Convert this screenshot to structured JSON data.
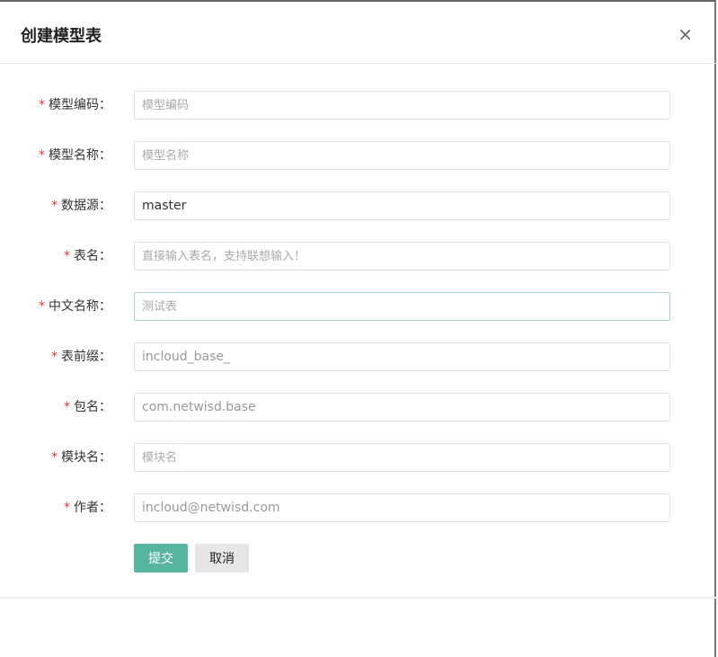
{
  "dialog": {
    "title": "创建模型表",
    "close_label": "×"
  },
  "form": {
    "fields": [
      {
        "label": "模型编码：",
        "value": "",
        "placeholder": "模型编码"
      },
      {
        "label": "模型名称：",
        "value": "",
        "placeholder": "模型名称"
      },
      {
        "label": "数据源：",
        "value": "master",
        "placeholder": ""
      },
      {
        "label": "表名：",
        "value": "",
        "placeholder": "直接输入表名，支持联想输入！"
      },
      {
        "label": "中文名称：",
        "value": "",
        "placeholder": "测试表"
      },
      {
        "label": "表前缀：",
        "value": "incloud_base_",
        "placeholder": ""
      },
      {
        "label": "包名：",
        "value": "com.netwisd.base",
        "placeholder": ""
      },
      {
        "label": "模块名：",
        "value": "",
        "placeholder": "模块名"
      },
      {
        "label": "作者：",
        "value": "incloud@netwisd.com",
        "placeholder": ""
      }
    ],
    "required_mark": "*",
    "submit_label": "提交",
    "cancel_label": "取消"
  },
  "colors": {
    "primary": "#57b5a0",
    "required": "#e4393c"
  }
}
